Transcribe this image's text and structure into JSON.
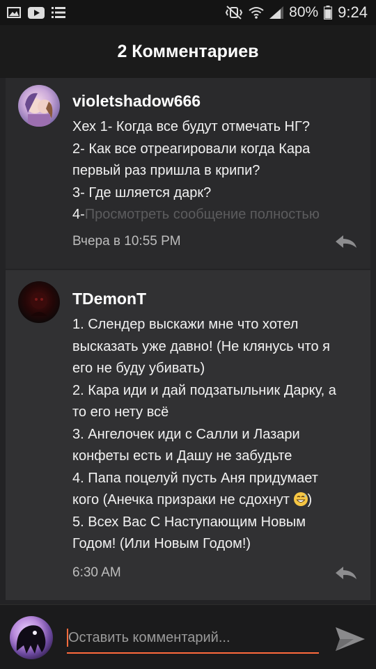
{
  "status_bar": {
    "battery": "80%",
    "time": "9:24"
  },
  "header": {
    "title": "2 Комментариев"
  },
  "comments": [
    {
      "username": "violetshadow666",
      "lines": [
        "Хех 1- Когда все будут отмечать НГ?",
        "2- Как все отреагировали когда Кара",
        "первый раз пришла в крипи?",
        "3- Где шляется дарк?"
      ],
      "last_line_prefix": "4-",
      "read_more": "Просмотреть сообщение полностью",
      "timestamp": "Вчера в 10:55 PM"
    },
    {
      "username": "TDemonT",
      "lines": [
        "1. Слендер выскажи мне что хотел",
        "высказать уже давно! (Не клянусь что я",
        "его не буду убивать)",
        "2. Кара иди и дай подзатыльник Дарку, а",
        "то его нету всё",
        "3. Ангелочек иди с Салли и Лазари",
        "конфеты есть и Дашу не забудьте",
        "4. Папа поцелуй пусть Аня придумает"
      ],
      "line_with_emoji": "кого (Анечка призраки не сдохнут ",
      "emoji_name": "grinning-sweat-emoji",
      "lines_after": [
        "5. Всех Вас С Наступающим Новым",
        "Годом! (Или Новым Годом!)"
      ],
      "timestamp": "6:30 AM"
    }
  ],
  "input": {
    "placeholder": "Оставить комментарий...",
    "value": ""
  },
  "colors": {
    "accent": "#ff6b3d",
    "background": "#232325"
  },
  "icons": {
    "reply": "reply-icon",
    "send": "send-icon"
  }
}
